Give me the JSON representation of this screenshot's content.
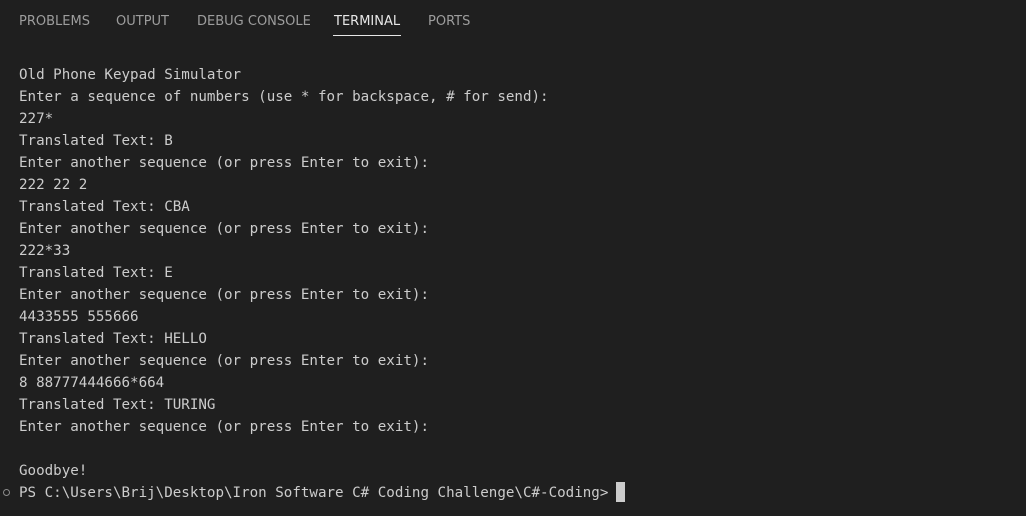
{
  "tabs": [
    {
      "label": "PROBLEMS",
      "active": false
    },
    {
      "label": "OUTPUT",
      "active": false
    },
    {
      "label": "DEBUG CONSOLE",
      "active": false
    },
    {
      "label": "TERMINAL",
      "active": true
    },
    {
      "label": "PORTS",
      "active": false
    }
  ],
  "terminal": {
    "lines": [
      "Old Phone Keypad Simulator",
      "Enter a sequence of numbers (use * for backspace, # for send):",
      "227*",
      "Translated Text: B",
      "Enter another sequence (or press Enter to exit):",
      "222 22 2",
      "Translated Text: CBA",
      "Enter another sequence (or press Enter to exit):",
      "222*33",
      "Translated Text: E",
      "Enter another sequence (or press Enter to exit):",
      "4433555 555666",
      "Translated Text: HELLO",
      "Enter another sequence (or press Enter to exit):",
      "8 88777444666*664",
      "Translated Text: TURING",
      "Enter another sequence (or press Enter to exit):",
      "",
      "Goodbye!"
    ],
    "prompt": "PS C:\\Users\\Brij\\Desktop\\Iron Software C# Coding Challenge\\C#-Coding>"
  },
  "colors": {
    "background": "#1f1f1f",
    "text": "#cccccc",
    "tab_inactive": "#9d9d9d",
    "tab_active": "#e7e7e7"
  },
  "icons": {
    "prompt_status": "circle-outline-icon",
    "cursor": "block-cursor"
  }
}
